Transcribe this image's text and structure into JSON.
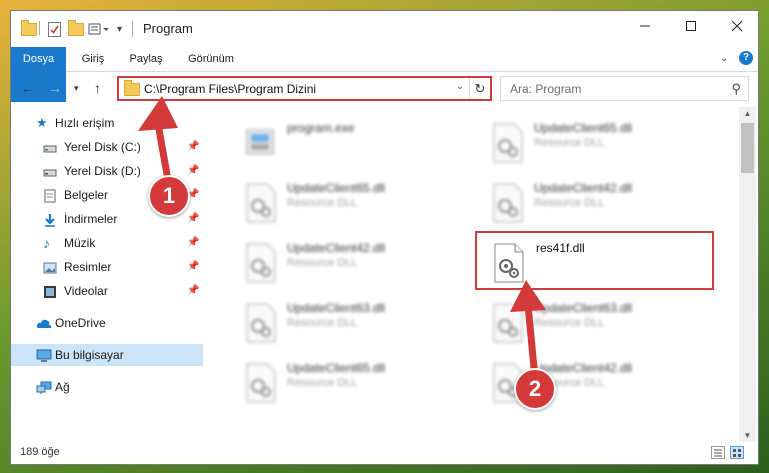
{
  "window": {
    "title": "Program"
  },
  "ribbon": {
    "tabs": [
      {
        "label": "Dosya",
        "active": true
      },
      {
        "label": "Giriş"
      },
      {
        "label": "Paylaş"
      },
      {
        "label": "Görünüm"
      }
    ]
  },
  "address": {
    "path": "C:\\Program Files\\Program Dizini"
  },
  "search": {
    "placeholder": "Ara: Program"
  },
  "nav": {
    "items": [
      {
        "label": "Hızlı erişim",
        "icon": "star-icon"
      },
      {
        "label": "Yerel Disk (C:)",
        "icon": "drive-icon",
        "pinned": true
      },
      {
        "label": "Yerel Disk (D:)",
        "icon": "drive-icon",
        "pinned": true
      },
      {
        "label": "Belgeler",
        "icon": "documents-icon",
        "pinned": true
      },
      {
        "label": "İndirmeler",
        "icon": "download-icon",
        "pinned": true
      },
      {
        "label": "Müzik",
        "icon": "music-icon",
        "pinned": true
      },
      {
        "label": "Resimler",
        "icon": "pictures-icon",
        "pinned": true
      },
      {
        "label": "Videolar",
        "icon": "videos-icon",
        "pinned": true
      },
      {
        "label": "OneDrive",
        "icon": "cloud-icon"
      },
      {
        "label": "Bu bilgisayar",
        "icon": "computer-icon",
        "selected": true
      },
      {
        "label": "Ağ",
        "icon": "network-icon"
      }
    ]
  },
  "files": [
    {
      "name": "program.exe",
      "type": ""
    },
    {
      "name": "UpdateClient65.dll",
      "type": "Resource DLL"
    },
    {
      "name": "UpdateClient65.dll",
      "type": "Resource DLL"
    },
    {
      "name": "UpdateClient42.dll",
      "type": "Resource DLL"
    },
    {
      "name": "UpdateClient42.dll",
      "type": "Resource DLL"
    },
    {
      "name": "res41f.dll",
      "type": "",
      "highlighted": true
    },
    {
      "name": "UpdateClient63.dll",
      "type": "Resource DLL"
    },
    {
      "name": "UpdateClient63.dll",
      "type": "Resource DLL"
    },
    {
      "name": "UpdateClient65.dll",
      "type": "Resource DLL"
    },
    {
      "name": "UpdateClient42.dll",
      "type": "Resource DLL"
    }
  ],
  "status": {
    "count": "189 öğe"
  },
  "annotations": {
    "step1": "1",
    "step2": "2"
  },
  "colors": {
    "accent": "#1979ca",
    "highlight": "#d43a3a",
    "selected": "#cce4f7"
  }
}
